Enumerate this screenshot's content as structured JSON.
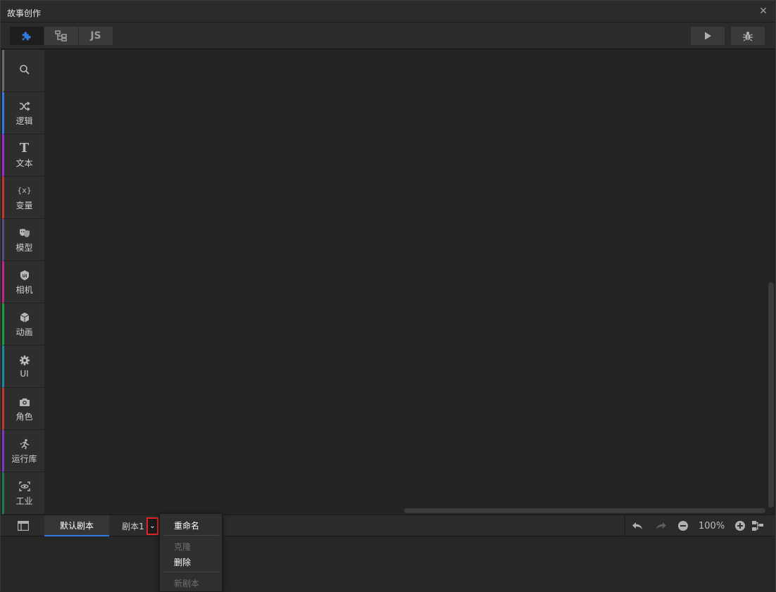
{
  "window": {
    "title": "故事创作",
    "close_glyph": "✕"
  },
  "toolbar": {
    "tabs": [
      {
        "name": "blocks",
        "icon": "puzzle-icon",
        "active": true
      },
      {
        "name": "flow",
        "icon": "flowchart-icon",
        "active": false
      },
      {
        "name": "js",
        "label": "JS",
        "active": false
      }
    ],
    "run_icon": "play-icon",
    "debug_icon": "bug-icon"
  },
  "sidebar": {
    "items": [
      {
        "label": "",
        "icon": "search-icon",
        "color": "#6a6a6a"
      },
      {
        "label": "逻辑",
        "icon": "shuffle-icon",
        "color": "#2f7be0"
      },
      {
        "label": "文本",
        "icon": "text-T-icon",
        "color": "#a12fc4"
      },
      {
        "label": "变量",
        "icon": "variable-icon",
        "color": "#c0392b"
      },
      {
        "label": "模型",
        "icon": "theater-masks-icon",
        "color": "#5a4a8a"
      },
      {
        "label": "相机",
        "icon": "camera-badge-icon",
        "color": "#c2258a"
      },
      {
        "label": "动画",
        "icon": "cube-icon",
        "color": "#1f9a3a"
      },
      {
        "label": "UI",
        "icon": "gear-icon",
        "color": "#1a8aa0"
      },
      {
        "label": "角色",
        "icon": "camera-icon",
        "color": "#c0392b"
      },
      {
        "label": "运行库",
        "icon": "runner-icon",
        "color": "#7a3ac0"
      },
      {
        "label": "工业",
        "icon": "focus-eye-icon",
        "color": "#1e7a4e"
      }
    ],
    "search_glyph": "⌕",
    "variable_glyph": "{x}",
    "text_glyph": "T"
  },
  "bottom": {
    "tabs": [
      {
        "label": "默认剧本",
        "active": true
      },
      {
        "label": "剧本1",
        "active": false
      }
    ],
    "dropdown_glyph": "⌄",
    "zoom": "100%"
  },
  "context_menu": {
    "items": [
      {
        "label": "重命名",
        "enabled": true
      },
      {
        "label": "克隆",
        "enabled": false
      },
      {
        "label": "删除",
        "enabled": true
      },
      {
        "label": "新剧本",
        "enabled": false
      }
    ]
  },
  "colors": {
    "accent": "#2f7be0",
    "highlight_border": "#e0242a",
    "active_tab_icon": "#2f7be0"
  }
}
